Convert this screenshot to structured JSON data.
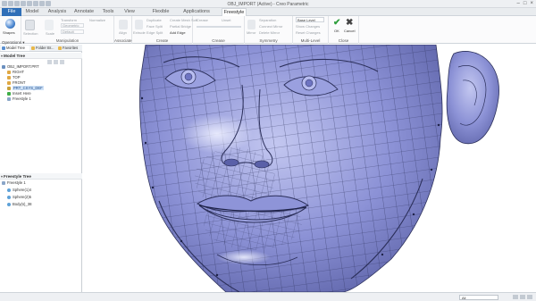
{
  "window": {
    "title": "OBJ_IMPORT (Active) - Creo Parametric"
  },
  "tabs": [
    {
      "label": "File"
    },
    {
      "label": "Model"
    },
    {
      "label": "Analysis"
    },
    {
      "label": "Annotate"
    },
    {
      "label": "Tools"
    },
    {
      "label": "View"
    },
    {
      "label": "Flexible Modeling"
    },
    {
      "label": "Applications"
    },
    {
      "label": "Freestyle"
    }
  ],
  "ribbon": {
    "shapes_label": "Shapes",
    "operations_label": "Operations",
    "manipulation": {
      "label": "Manipulation",
      "items": [
        "Selection",
        "Scale",
        "Geometric",
        "Default",
        "Transform",
        "Normalize"
      ]
    },
    "associate": {
      "label": "Associate",
      "item": "Align"
    },
    "create": {
      "label": "Create",
      "items": [
        "Extrude",
        "Duplicate",
        "Face Split",
        "Edge Split",
        "Create Mesh Soft",
        "Edge Soft",
        "Partial Bridge",
        "Add Edge"
      ],
      "add_edge": "Add Edge"
    },
    "crease": {
      "label": "Crease",
      "items": [
        "Crease",
        "Unset"
      ]
    },
    "symmetry": {
      "label": "Symmetry",
      "items": [
        "Mirror",
        "Separation",
        "Connect Mirror",
        "Delete Mirror"
      ]
    },
    "multilevel": {
      "label": "Multi-Level",
      "dropdown": "Base Level",
      "items": [
        "Show Changes",
        "Reset Changes"
      ]
    },
    "close": {
      "label": "Close",
      "ok": "OK",
      "cancel": "Cancel"
    }
  },
  "sidebar": {
    "tabs": [
      "Model Tree",
      "Folder Br...",
      "Favorites"
    ],
    "model_tree": {
      "title": "Model Tree",
      "items": [
        "OBJ_IMPORT.PRT",
        "RIGHT",
        "TOP",
        "FRONT",
        "PRT_CSYS_DEF",
        "Insert Here",
        "Freestyle 1"
      ]
    },
    "freestyle_tree": {
      "title": "Freestyle Tree",
      "items": [
        "Freestyle 1",
        "Sphere(1)4",
        "Sphere(2)5",
        "Body(s)_38"
      ]
    }
  },
  "status": {
    "filter_value": "All"
  },
  "colors": {
    "face_fill": "#7f86cf",
    "mesh_lines": "#2b2f5a",
    "ribbon_accent": "#2f6fb8"
  },
  "icons": [
    "shapes-icon",
    "ok-icon",
    "cancel-icon",
    "close-icon",
    "minimize-icon",
    "maximize-icon"
  ]
}
